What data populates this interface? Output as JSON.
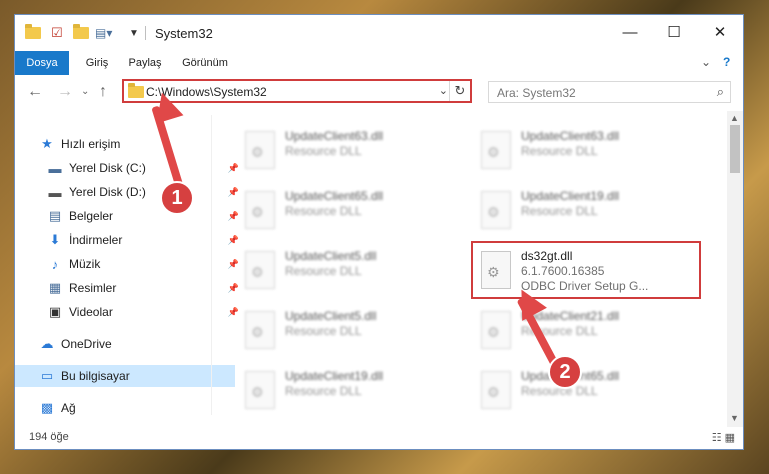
{
  "window": {
    "title": "System32",
    "controls": {
      "minimize": "—",
      "maximize": "☐",
      "close": "✕"
    }
  },
  "ribbon": {
    "tabs": [
      "Dosya",
      "Giriş",
      "Paylaş",
      "Görünüm"
    ],
    "active_tab": "Dosya",
    "collapse_glyph": "⌄",
    "help_glyph": "?"
  },
  "address": {
    "path": "C:\\Windows\\System32",
    "search_placeholder": "Ara: System32"
  },
  "nav": {
    "items": [
      {
        "label": "Hızlı erişim",
        "icon": "star-icon",
        "glyph": "★",
        "color": "#2b7ad6",
        "pinned": false
      },
      {
        "label": "Yerel Disk (C:)",
        "icon": "drive-icon",
        "glyph": "▬",
        "color": "#4a6f9a",
        "pinned": true
      },
      {
        "label": "Yerel Disk (D:)",
        "icon": "drive-icon",
        "glyph": "▬",
        "color": "#555555",
        "pinned": true
      },
      {
        "label": "Belgeler",
        "icon": "documents-icon",
        "glyph": "▤",
        "color": "#4a6f9a",
        "pinned": true
      },
      {
        "label": "İndirmeler",
        "icon": "downloads-icon",
        "glyph": "⬇",
        "color": "#2b7ad6",
        "pinned": true
      },
      {
        "label": "Müzik",
        "icon": "music-icon",
        "glyph": "♪",
        "color": "#2b7ad6",
        "pinned": true
      },
      {
        "label": "Resimler",
        "icon": "pictures-icon",
        "glyph": "▦",
        "color": "#4a6f9a",
        "pinned": true
      },
      {
        "label": "Videolar",
        "icon": "videos-icon",
        "glyph": "▣",
        "color": "#333333",
        "pinned": true
      },
      {
        "label": "OneDrive",
        "icon": "onedrive-icon",
        "glyph": "☁",
        "color": "#2b7ad6",
        "pinned": false
      },
      {
        "label": "Bu bilgisayar",
        "icon": "computer-icon",
        "glyph": "▭",
        "color": "#2b7ad6",
        "pinned": false
      },
      {
        "label": "Ağ",
        "icon": "network-icon",
        "glyph": "▩",
        "color": "#2b7ad6",
        "pinned": false
      }
    ],
    "selected": "Bu bilgisayar"
  },
  "files": [
    {
      "name": "UpdateClient63.dll",
      "l1": "Resource DLL",
      "l2": ""
    },
    {
      "name": "UpdateClient63.dll",
      "l1": "Resource DLL",
      "l2": ""
    },
    {
      "name": "UpdateClient65.dll",
      "l1": "Resource DLL",
      "l2": ""
    },
    {
      "name": "UpdateClient19.dll",
      "l1": "Resource DLL",
      "l2": ""
    },
    {
      "name": "UpdateClient5.dll",
      "l1": "Resource DLL",
      "l2": ""
    },
    {
      "name": "ds32gt.dll",
      "l1": "6.1.7600.16385",
      "l2": "ODBC Driver Setup G..."
    },
    {
      "name": "UpdateClient5.dll",
      "l1": "Resource DLL",
      "l2": ""
    },
    {
      "name": "UpdateClient21.dll",
      "l1": "Resource DLL",
      "l2": ""
    },
    {
      "name": "UpdateClient19.dll",
      "l1": "Resource DLL",
      "l2": ""
    },
    {
      "name": "UpdateClient65.dll",
      "l1": "Resource DLL",
      "l2": ""
    }
  ],
  "status": {
    "count": "194 öğe"
  },
  "annotations": {
    "badge1": "1",
    "badge2": "2",
    "color": "#d64040"
  }
}
